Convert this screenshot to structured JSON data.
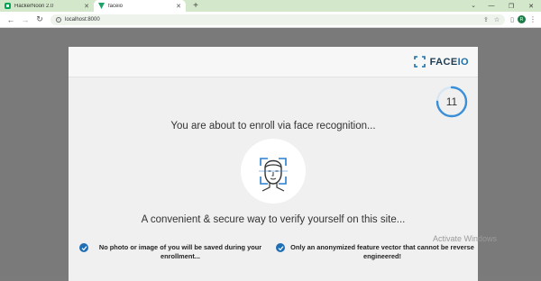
{
  "browser": {
    "tabs": [
      {
        "title": "HackerNoon 2.0",
        "active": false
      },
      {
        "title": "faceio",
        "active": true
      }
    ],
    "new_tab": "+",
    "url": "localhost:8000",
    "profile_initial": "R"
  },
  "modal": {
    "brand_prefix": "FACE",
    "brand_suffix": "IO",
    "countdown": "11",
    "countdown_fraction": 0.75,
    "headline": "You are about to enroll via face recognition...",
    "subline": "A convenient & secure way to verify yourself on this site...",
    "notes": [
      {
        "text": "No photo or image of you will be saved during your enrollment..."
      },
      {
        "text": "Only an anonymized feature vector that cannot be reverse engineered!"
      }
    ]
  },
  "watermark": "Activate Windows",
  "colors": {
    "accent": "#1f6fb5",
    "brand_dark": "#1d3b52",
    "tab_strip": "#d3e8ca"
  }
}
